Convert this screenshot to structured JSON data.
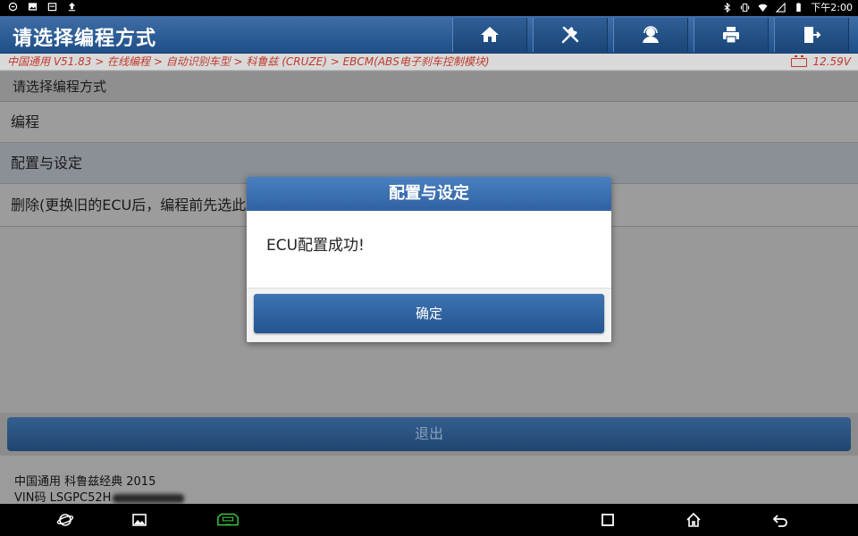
{
  "status_bar": {
    "time": "下午2:00",
    "left_icons": [
      "sync-icon",
      "image-icon",
      "calendar-icon",
      "upload-icon"
    ],
    "right_icons": [
      "bluetooth-icon",
      "vibrate-icon",
      "wifi-icon",
      "signal-icon",
      "battery-icon"
    ]
  },
  "header": {
    "title": "请选择编程方式",
    "buttons": [
      "home-icon",
      "tools-icon",
      "support-agent-icon",
      "printer-icon",
      "exit-icon"
    ]
  },
  "breadcrumb": {
    "path": "中国通用 V51.83 > 在线编程 > 自动识别车型 > 科鲁兹 (CRUZE) > EBCM(ABS电子刹车控制模块)",
    "voltage": "12.59V"
  },
  "list": {
    "heading": "请选择编程方式",
    "items": [
      {
        "label": "编程"
      },
      {
        "label": "配置与设定"
      },
      {
        "label": "删除(更换旧的ECU后，编程前先选此"
      }
    ]
  },
  "exit_button": {
    "label": "退出"
  },
  "footer": {
    "vehicle": "中国通用 科鲁兹经典 2015",
    "vin": "VIN码 LSGPC52H"
  },
  "dialog": {
    "title": "配置与设定",
    "message": "ECU配置成功!",
    "ok_label": "确定"
  },
  "nav_bar": {
    "icons": [
      "browser-icon",
      "gallery-icon",
      "vci-icon",
      "recent-apps-icon",
      "home-nav-icon",
      "back-icon"
    ]
  },
  "colors": {
    "header_blue": "#2a5a92",
    "breadcrumb_red": "#c0392b",
    "dialog_blue": "#3569a9"
  }
}
